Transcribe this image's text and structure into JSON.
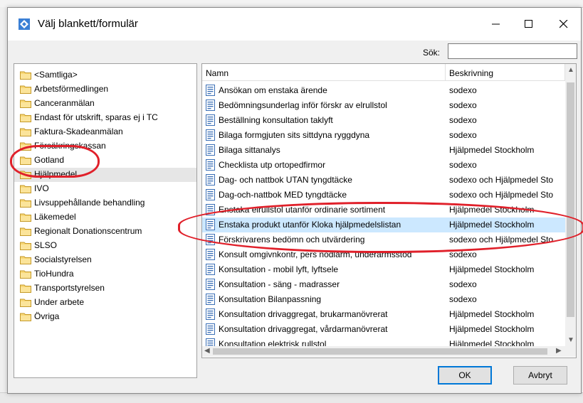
{
  "dialog": {
    "title": "Välj blankett/formulär",
    "search_label": "Sök:",
    "search_value": ""
  },
  "folders": [
    {
      "label": "<Samtliga>"
    },
    {
      "label": "Arbetsförmedlingen"
    },
    {
      "label": "Canceranmälan"
    },
    {
      "label": "Endast för utskrift, sparas ej i TC"
    },
    {
      "label": "Faktura-Skadeanmälan"
    },
    {
      "label": "Försäkringskassan"
    },
    {
      "label": "Gotland"
    },
    {
      "label": "Hjälpmedel",
      "selected": true
    },
    {
      "label": "IVO"
    },
    {
      "label": "Livsuppehållande behandling"
    },
    {
      "label": "Läkemedel"
    },
    {
      "label": "Regionalt Donationscentrum"
    },
    {
      "label": "SLSO"
    },
    {
      "label": "Socialstyrelsen"
    },
    {
      "label": "TioHundra"
    },
    {
      "label": "Transportstyrelsen"
    },
    {
      "label": "Under arbete"
    },
    {
      "label": "Övriga"
    }
  ],
  "list": {
    "columns": {
      "name": "Namn",
      "description": "Beskrivning"
    },
    "rows": [
      {
        "name": "Ansökan om enstaka ärende",
        "description": "sodexo"
      },
      {
        "name": "Bedömningsunderlag inför förskr av elrullstol",
        "description": "sodexo"
      },
      {
        "name": "Beställning konsultation taklyft",
        "description": "sodexo"
      },
      {
        "name": "Bilaga formgjuten sits sittdyna ryggdyna",
        "description": "sodexo"
      },
      {
        "name": "Bilaga sittanalys",
        "description": "Hjälpmedel Stockholm"
      },
      {
        "name": "Checklista utp ortopedfirmor",
        "description": "sodexo"
      },
      {
        "name": "Dag- och nattbok UTAN tyngdtäcke",
        "description": "sodexo och Hjälpmedel Sto"
      },
      {
        "name": "Dag-och-nattbok MED tyngdtäcke",
        "description": "sodexo och Hjälpmedel Sto"
      },
      {
        "name": "Enstaka elrullstol utanför ordinarie sortiment",
        "description": "Hjälpmedel Stockholm"
      },
      {
        "name": "Enstaka produkt utanför Kloka hjälpmedelslistan",
        "description": "Hjälpmedel Stockholm",
        "selected": true
      },
      {
        "name": "Förskrivarens bedömn och utvärdering",
        "description": "sodexo och Hjälpmedel Sto"
      },
      {
        "name": "Konsult omgivnkontr, pers nödlarm, underarmsstöd",
        "description": "sodexo"
      },
      {
        "name": "Konsultation - mobil lyft, lyftsele",
        "description": "Hjälpmedel Stockholm"
      },
      {
        "name": "Konsultation - säng - madrasser",
        "description": "sodexo"
      },
      {
        "name": "Konsultation Bilanpassning",
        "description": "sodexo"
      },
      {
        "name": "Konsultation drivaggregat, brukarmanövrerat",
        "description": "Hjälpmedel Stockholm"
      },
      {
        "name": "Konsultation drivaggregat, vårdarmanövrerat",
        "description": "Hjälpmedel Stockholm"
      },
      {
        "name": "Konsultation elektrisk rullstol",
        "description": "Hjälpmedel Stockholm"
      }
    ]
  },
  "buttons": {
    "ok": "OK",
    "cancel": "Avbryt"
  },
  "colors": {
    "selection": "#cce8ff",
    "annotation": "#e0202a",
    "accent": "#0078d7"
  }
}
